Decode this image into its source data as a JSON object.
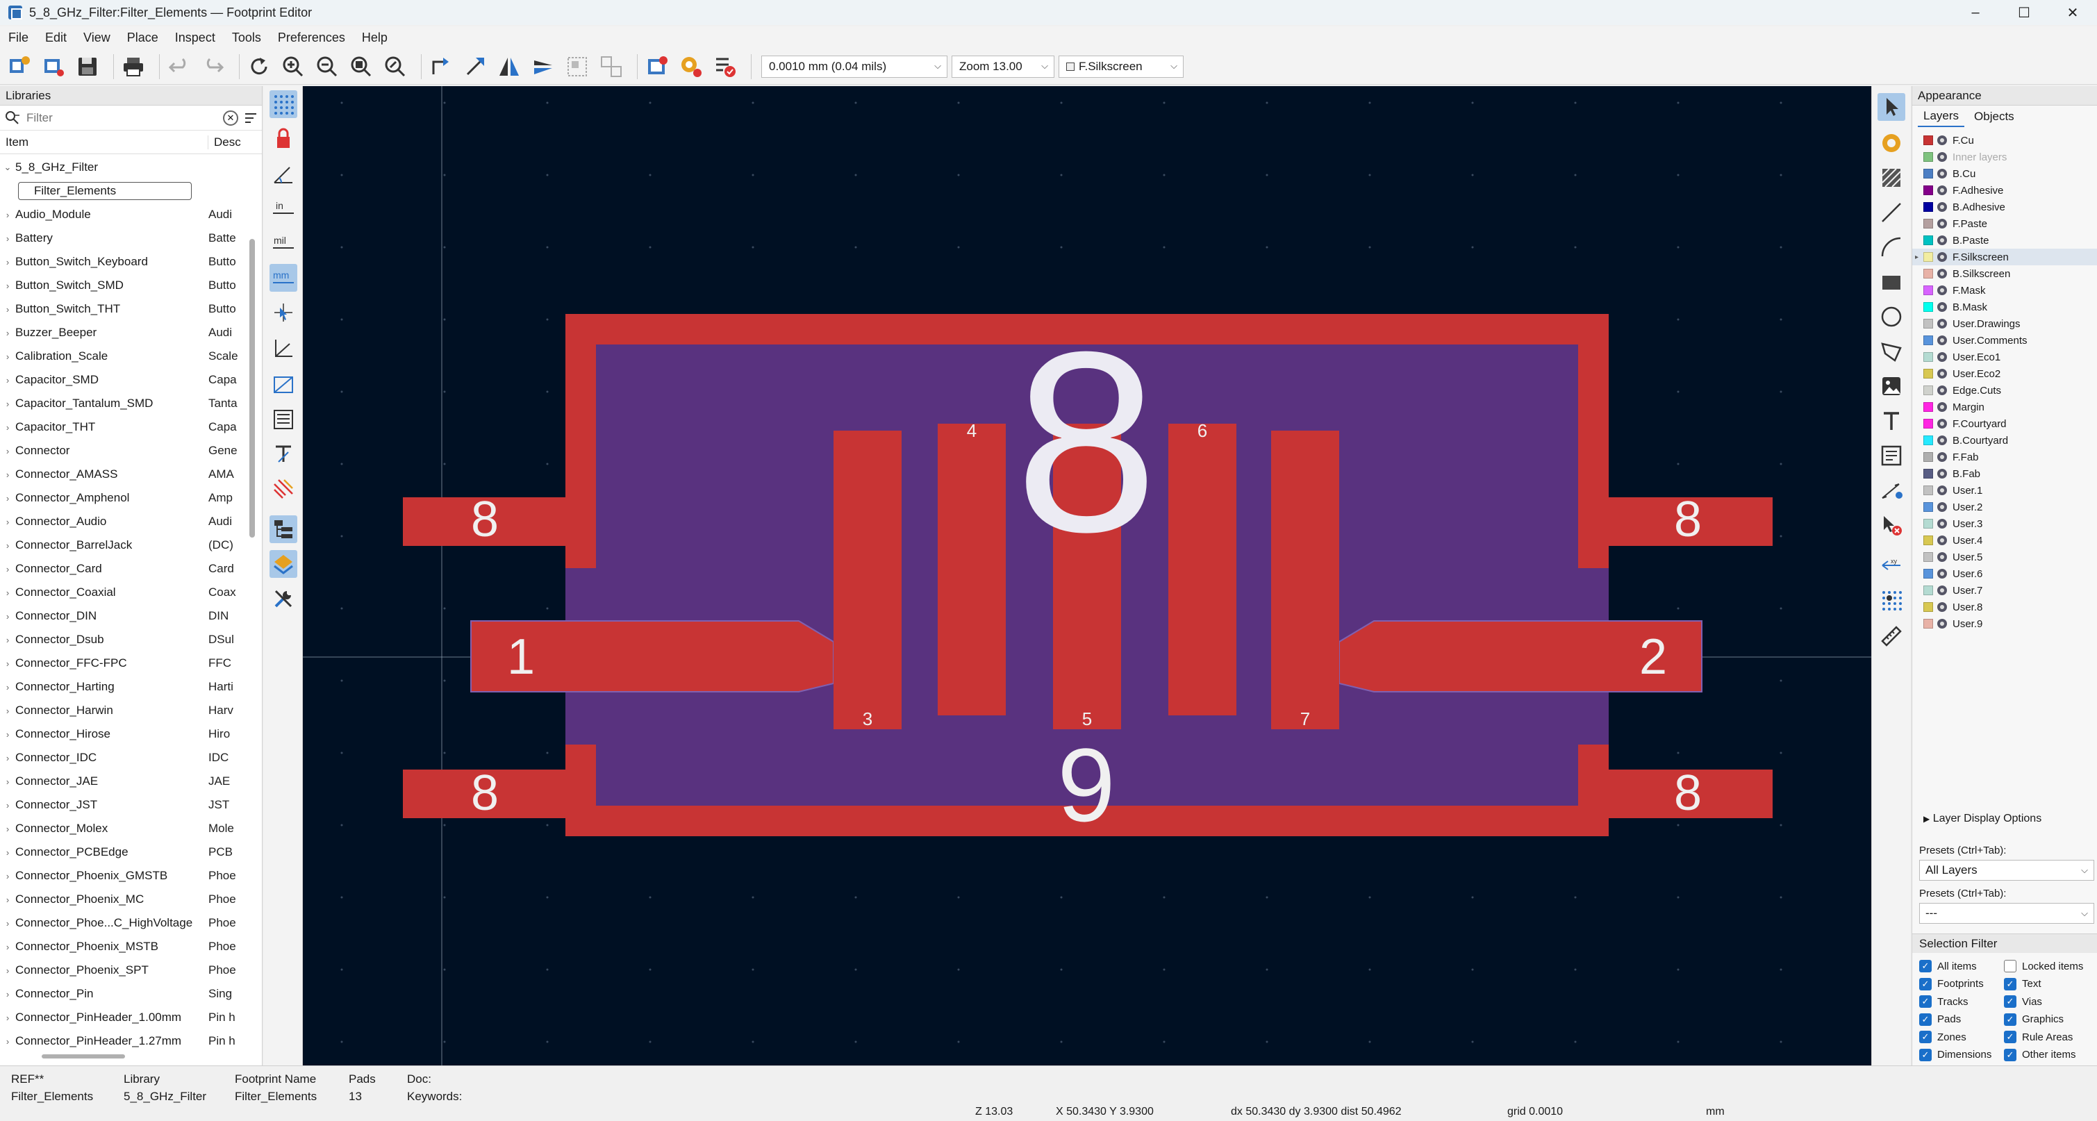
{
  "window": {
    "title": "5_8_GHz_Filter:Filter_Elements — Footprint Editor",
    "controls": [
      "–",
      "☐",
      "✕"
    ]
  },
  "menu": [
    "File",
    "Edit",
    "View",
    "Place",
    "Inspect",
    "Tools",
    "Preferences",
    "Help"
  ],
  "toolbar": {
    "grid_value": "0.0010 mm (0.04 mils)",
    "zoom_value": "Zoom 13.00",
    "layer_value": "F.Silkscreen"
  },
  "libraries": {
    "title": "Libraries",
    "filter_placeholder": "Filter",
    "col_item": "Item",
    "col_desc": "Desc",
    "expanded_library": "5_8_GHz_Filter",
    "selected_child": "Filter_Elements",
    "items": [
      {
        "name": "Audio_Module",
        "desc": "Audi"
      },
      {
        "name": "Battery",
        "desc": "Batte"
      },
      {
        "name": "Button_Switch_Keyboard",
        "desc": "Butto"
      },
      {
        "name": "Button_Switch_SMD",
        "desc": "Butto"
      },
      {
        "name": "Button_Switch_THT",
        "desc": "Butto"
      },
      {
        "name": "Buzzer_Beeper",
        "desc": "Audi"
      },
      {
        "name": "Calibration_Scale",
        "desc": "Scale"
      },
      {
        "name": "Capacitor_SMD",
        "desc": "Capa"
      },
      {
        "name": "Capacitor_Tantalum_SMD",
        "desc": "Tanta"
      },
      {
        "name": "Capacitor_THT",
        "desc": "Capa"
      },
      {
        "name": "Connector",
        "desc": "Gene"
      },
      {
        "name": "Connector_AMASS",
        "desc": "AMA"
      },
      {
        "name": "Connector_Amphenol",
        "desc": "Amp"
      },
      {
        "name": "Connector_Audio",
        "desc": "Audi"
      },
      {
        "name": "Connector_BarrelJack",
        "desc": "(DC)"
      },
      {
        "name": "Connector_Card",
        "desc": "Card"
      },
      {
        "name": "Connector_Coaxial",
        "desc": "Coax"
      },
      {
        "name": "Connector_DIN",
        "desc": "DIN"
      },
      {
        "name": "Connector_Dsub",
        "desc": "DSul"
      },
      {
        "name": "Connector_FFC-FPC",
        "desc": "FFC"
      },
      {
        "name": "Connector_Harting",
        "desc": "Harti"
      },
      {
        "name": "Connector_Harwin",
        "desc": "Harv"
      },
      {
        "name": "Connector_Hirose",
        "desc": "Hiro"
      },
      {
        "name": "Connector_IDC",
        "desc": "IDC"
      },
      {
        "name": "Connector_JAE",
        "desc": "JAE"
      },
      {
        "name": "Connector_JST",
        "desc": "JST"
      },
      {
        "name": "Connector_Molex",
        "desc": "Mole"
      },
      {
        "name": "Connector_PCBEdge",
        "desc": "PCB"
      },
      {
        "name": "Connector_Phoenix_GMSTB",
        "desc": "Phoe"
      },
      {
        "name": "Connector_Phoenix_MC",
        "desc": "Phoe"
      },
      {
        "name": "Connector_Phoe...C_HighVoltage",
        "desc": "Phoe"
      },
      {
        "name": "Connector_Phoenix_MSTB",
        "desc": "Phoe"
      },
      {
        "name": "Connector_Phoenix_SPT",
        "desc": "Phoe"
      },
      {
        "name": "Connector_Pin",
        "desc": "Sing"
      },
      {
        "name": "Connector_PinHeader_1.00mm",
        "desc": "Pin h"
      },
      {
        "name": "Connector_PinHeader_1.27mm",
        "desc": "Pin h"
      }
    ]
  },
  "canvas": {
    "pads": [
      "8",
      "8",
      "8",
      "8",
      "1",
      "2",
      "3",
      "4",
      "5",
      "6",
      "7",
      "9"
    ],
    "big_label": "8",
    "colors": {
      "background": "#001023",
      "copper": "#c83434",
      "fab": "#59327f"
    }
  },
  "appearance": {
    "title": "Appearance",
    "tabs": [
      "Layers",
      "Objects"
    ],
    "layers": [
      {
        "name": "F.Cu",
        "color": "#c83434"
      },
      {
        "name": "Inner layers",
        "color": "#7fc37f",
        "dim": true
      },
      {
        "name": "B.Cu",
        "color": "#4d7fc4"
      },
      {
        "name": "F.Adhesive",
        "color": "#84008a"
      },
      {
        "name": "B.Adhesive",
        "color": "#0000a0"
      },
      {
        "name": "F.Paste",
        "color": "#b4a0a0"
      },
      {
        "name": "B.Paste",
        "color": "#00c2c2"
      },
      {
        "name": "F.Silkscreen",
        "color": "#f2eda1",
        "selected": true
      },
      {
        "name": "B.Silkscreen",
        "color": "#e8b2a7"
      },
      {
        "name": "F.Mask",
        "color": "#d864ff"
      },
      {
        "name": "B.Mask",
        "color": "#02ffee"
      },
      {
        "name": "User.Drawings",
        "color": "#c2c2c2"
      },
      {
        "name": "User.Comments",
        "color": "#5994dc"
      },
      {
        "name": "User.Eco1",
        "color": "#b4dbd2"
      },
      {
        "name": "User.Eco2",
        "color": "#d8c852"
      },
      {
        "name": "Edge.Cuts",
        "color": "#d0d2cd"
      },
      {
        "name": "Margin",
        "color": "#ff26e2"
      },
      {
        "name": "F.Courtyard",
        "color": "#ff26e2"
      },
      {
        "name": "B.Courtyard",
        "color": "#26e9ff"
      },
      {
        "name": "F.Fab",
        "color": "#afafaf"
      },
      {
        "name": "B.Fab",
        "color": "#585d84"
      },
      {
        "name": "User.1",
        "color": "#c2c2c2"
      },
      {
        "name": "User.2",
        "color": "#5994dc"
      },
      {
        "name": "User.3",
        "color": "#b4dbd2"
      },
      {
        "name": "User.4",
        "color": "#d8c852"
      },
      {
        "name": "User.5",
        "color": "#c2c2c2"
      },
      {
        "name": "User.6",
        "color": "#5994dc"
      },
      {
        "name": "User.7",
        "color": "#b4dbd2"
      },
      {
        "name": "User.8",
        "color": "#d8c852"
      },
      {
        "name": "User.9",
        "color": "#e8b2a7"
      }
    ],
    "layer_display_options": "Layer Display Options",
    "presets_label": "Presets (Ctrl+Tab):",
    "presets_value": "All Layers",
    "presets2_label": "Presets (Ctrl+Tab):",
    "presets2_value": "---",
    "selection_filter_title": "Selection Filter",
    "selection_filter": {
      "left": [
        {
          "label": "All items",
          "checked": true
        },
        {
          "label": "Footprints",
          "checked": true
        },
        {
          "label": "Tracks",
          "checked": true
        },
        {
          "label": "Pads",
          "checked": true
        },
        {
          "label": "Zones",
          "checked": true
        },
        {
          "label": "Dimensions",
          "checked": true
        }
      ],
      "right": [
        {
          "label": "Locked items",
          "checked": false
        },
        {
          "label": "Text",
          "checked": true
        },
        {
          "label": "Vias",
          "checked": true
        },
        {
          "label": "Graphics",
          "checked": true
        },
        {
          "label": "Rule Areas",
          "checked": true
        },
        {
          "label": "Other items",
          "checked": true
        }
      ]
    }
  },
  "info": {
    "ref_label": "REF**",
    "ref_value": "Filter_Elements",
    "library_label": "Library",
    "library_value": "5_8_GHz_Filter",
    "fpname_label": "Footprint Name",
    "fpname_value": "Filter_Elements",
    "pads_label": "Pads",
    "pads_value": "13",
    "doc_label": "Doc:",
    "keywords_label": "Keywords:"
  },
  "status": {
    "zoom": "Z 13.03",
    "xy": "X 50.3430  Y 3.9300",
    "delta": "dx 50.3430  dy 3.9300  dist 50.4962",
    "grid": "grid 0.0010",
    "units": "mm"
  }
}
